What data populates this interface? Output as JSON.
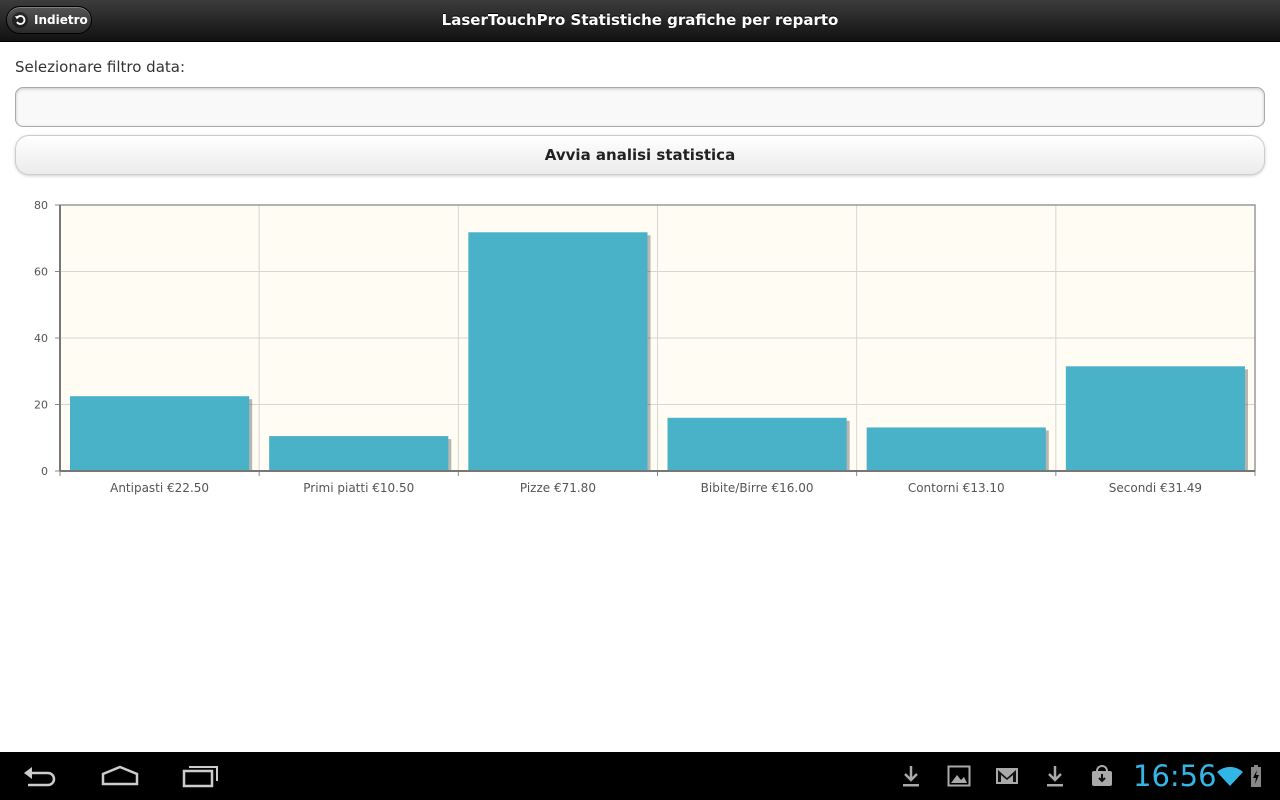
{
  "header": {
    "back_label": "Indietro",
    "title": "LaserTouchPro Statistiche grafiche per reparto"
  },
  "form": {
    "filter_label": "Selezionare filtro data:",
    "date_value": "",
    "run_button_label": "Avvia analisi statistica"
  },
  "chart_data": {
    "type": "bar",
    "categories": [
      "Antipasti €22.50",
      "Primi piatti €10.50",
      "Pizze €71.80",
      "Bibite/Birre €16.00",
      "Contorni €13.10",
      "Secondi €31.49"
    ],
    "values": [
      22.5,
      10.5,
      71.8,
      16.0,
      13.1,
      31.49
    ],
    "ylim": [
      0,
      80
    ],
    "yticks": [
      0,
      20,
      40,
      60,
      80
    ],
    "grid": true,
    "bar_color": "#4ab2c8",
    "plot_background": "#fffcf4"
  },
  "statusbar": {
    "clock": "16:56",
    "clock_color": "#33b5e5",
    "icons": [
      "download-icon",
      "image-icon",
      "gmail-icon",
      "download-icon",
      "store-icon",
      "wifi-icon",
      "battery-charging-icon"
    ]
  }
}
